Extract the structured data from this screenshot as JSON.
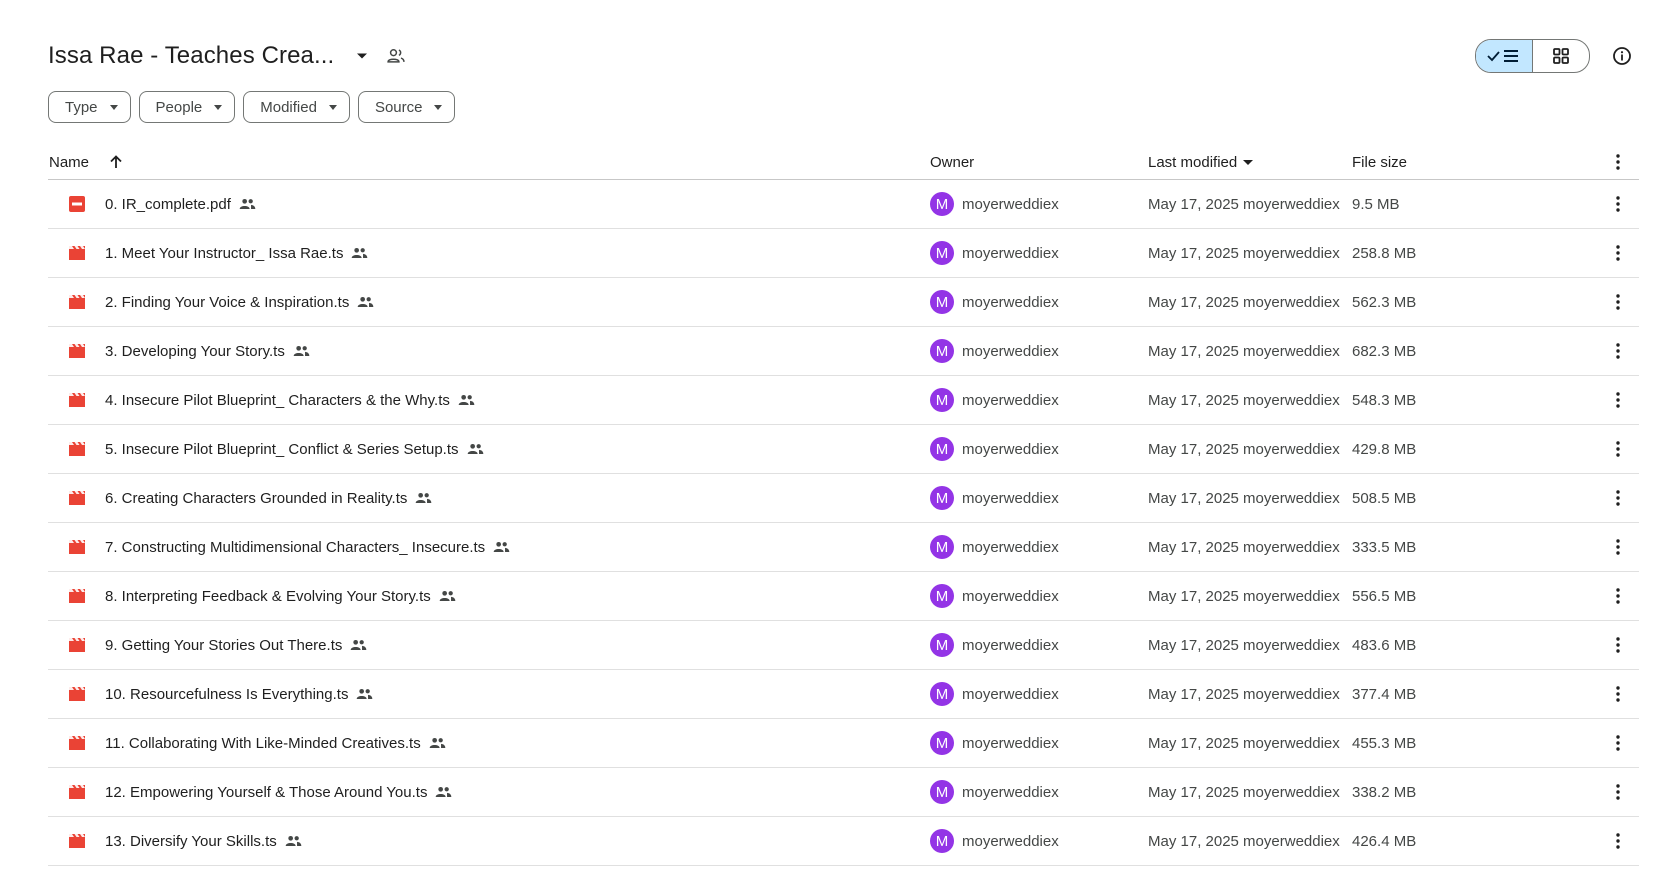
{
  "header": {
    "title": "Issa Rae - Teaches Crea..."
  },
  "filters": [
    {
      "label": "Type"
    },
    {
      "label": "People"
    },
    {
      "label": "Modified"
    },
    {
      "label": "Source"
    }
  ],
  "columns": {
    "name": "Name",
    "owner": "Owner",
    "modified": "Last modified",
    "size": "File size"
  },
  "colors": {
    "accent": "#c2e7ff",
    "avatar": "#9334e6",
    "file_icon": "#ea4335"
  },
  "files": [
    {
      "name": "0. IR_complete.pdf",
      "type": "pdf-icon",
      "owner": "moyerweddiex",
      "owner_initial": "M",
      "modified": "May 17, 2025 moyerweddiex",
      "size": "9.5 MB"
    },
    {
      "name": "1. Meet Your Instructor_ Issa Rae.ts",
      "type": "video-icon",
      "owner": "moyerweddiex",
      "owner_initial": "M",
      "modified": "May 17, 2025 moyerweddiex",
      "size": "258.8 MB"
    },
    {
      "name": "2. Finding Your Voice & Inspiration.ts",
      "type": "video-icon",
      "owner": "moyerweddiex",
      "owner_initial": "M",
      "modified": "May 17, 2025 moyerweddiex",
      "size": "562.3 MB"
    },
    {
      "name": "3. Developing Your Story.ts",
      "type": "video-icon",
      "owner": "moyerweddiex",
      "owner_initial": "M",
      "modified": "May 17, 2025 moyerweddiex",
      "size": "682.3 MB"
    },
    {
      "name": "4. Insecure Pilot Blueprint_ Characters & the Why.ts",
      "type": "video-icon",
      "owner": "moyerweddiex",
      "owner_initial": "M",
      "modified": "May 17, 2025 moyerweddiex",
      "size": "548.3 MB"
    },
    {
      "name": "5. Insecure Pilot Blueprint_ Conflict & Series Setup.ts",
      "type": "video-icon",
      "owner": "moyerweddiex",
      "owner_initial": "M",
      "modified": "May 17, 2025 moyerweddiex",
      "size": "429.8 MB"
    },
    {
      "name": "6. Creating Characters Grounded in Reality.ts",
      "type": "video-icon",
      "owner": "moyerweddiex",
      "owner_initial": "M",
      "modified": "May 17, 2025 moyerweddiex",
      "size": "508.5 MB"
    },
    {
      "name": "7. Constructing Multidimensional Characters_ Insecure.ts",
      "type": "video-icon",
      "owner": "moyerweddiex",
      "owner_initial": "M",
      "modified": "May 17, 2025 moyerweddiex",
      "size": "333.5 MB"
    },
    {
      "name": "8. Interpreting Feedback & Evolving Your Story.ts",
      "type": "video-icon",
      "owner": "moyerweddiex",
      "owner_initial": "M",
      "modified": "May 17, 2025 moyerweddiex",
      "size": "556.5 MB"
    },
    {
      "name": "9. Getting Your Stories Out There.ts",
      "type": "video-icon",
      "owner": "moyerweddiex",
      "owner_initial": "M",
      "modified": "May 17, 2025 moyerweddiex",
      "size": "483.6 MB"
    },
    {
      "name": "10. Resourcefulness Is Everything.ts",
      "type": "video-icon",
      "owner": "moyerweddiex",
      "owner_initial": "M",
      "modified": "May 17, 2025 moyerweddiex",
      "size": "377.4 MB"
    },
    {
      "name": "11. Collaborating With Like-Minded Creatives.ts",
      "type": "video-icon",
      "owner": "moyerweddiex",
      "owner_initial": "M",
      "modified": "May 17, 2025 moyerweddiex",
      "size": "455.3 MB"
    },
    {
      "name": "12. Empowering Yourself & Those Around You.ts",
      "type": "video-icon",
      "owner": "moyerweddiex",
      "owner_initial": "M",
      "modified": "May 17, 2025 moyerweddiex",
      "size": "338.2 MB"
    },
    {
      "name": "13. Diversify Your Skills.ts",
      "type": "video-icon",
      "owner": "moyerweddiex",
      "owner_initial": "M",
      "modified": "May 17, 2025 moyerweddiex",
      "size": "426.4 MB"
    }
  ]
}
